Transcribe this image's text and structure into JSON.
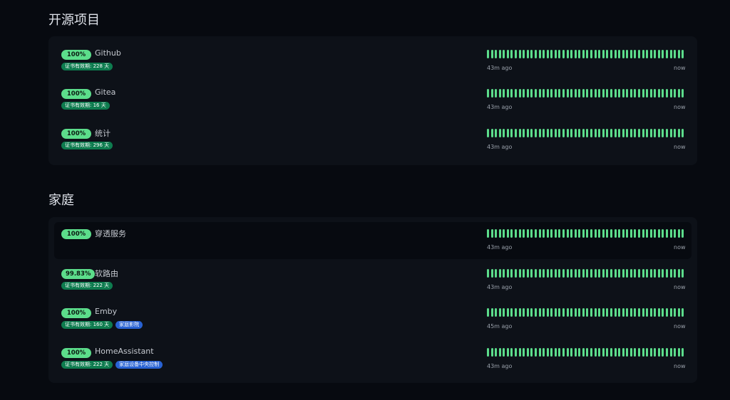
{
  "colors": {
    "background": "#070a10",
    "panel": "#0d1118",
    "up": "#5cdd8b",
    "cert_tag": "#0e7c4f",
    "tag_blue": "#2862d3"
  },
  "groups": [
    {
      "title": "开源项目",
      "monitors": [
        {
          "uptime": "100%",
          "name": "Github",
          "tags": [
            "证书有效期: 228 天"
          ],
          "from": "43m ago",
          "to": "now",
          "beats": 50
        },
        {
          "uptime": "100%",
          "name": "Gitea",
          "tags": [
            "证书有效期: 16 天"
          ],
          "from": "43m ago",
          "to": "now",
          "beats": 50
        },
        {
          "uptime": "100%",
          "name": "统计",
          "tags": [
            "证书有效期: 296 天"
          ],
          "from": "43m ago",
          "to": "now",
          "beats": 50
        }
      ]
    },
    {
      "title": "家庭",
      "monitors": [
        {
          "uptime": "100%",
          "name": "穿透服务",
          "tags": [],
          "from": "43m ago",
          "to": "now",
          "beats": 50
        },
        {
          "uptime": "99.83%",
          "name": "软路由",
          "tags": [
            "证书有效期: 222 天"
          ],
          "from": "43m ago",
          "to": "now",
          "beats": 50
        },
        {
          "uptime": "100%",
          "name": "Emby",
          "tags": [
            "证书有效期: 160 天",
            "家庭影院"
          ],
          "from": "45m ago",
          "to": "now",
          "beats": 50
        },
        {
          "uptime": "100%",
          "name": "HomeAssistant",
          "tags": [
            "证书有效期: 222 天",
            "家庭设备中央控制"
          ],
          "from": "43m ago",
          "to": "now",
          "beats": 50
        }
      ]
    }
  ]
}
